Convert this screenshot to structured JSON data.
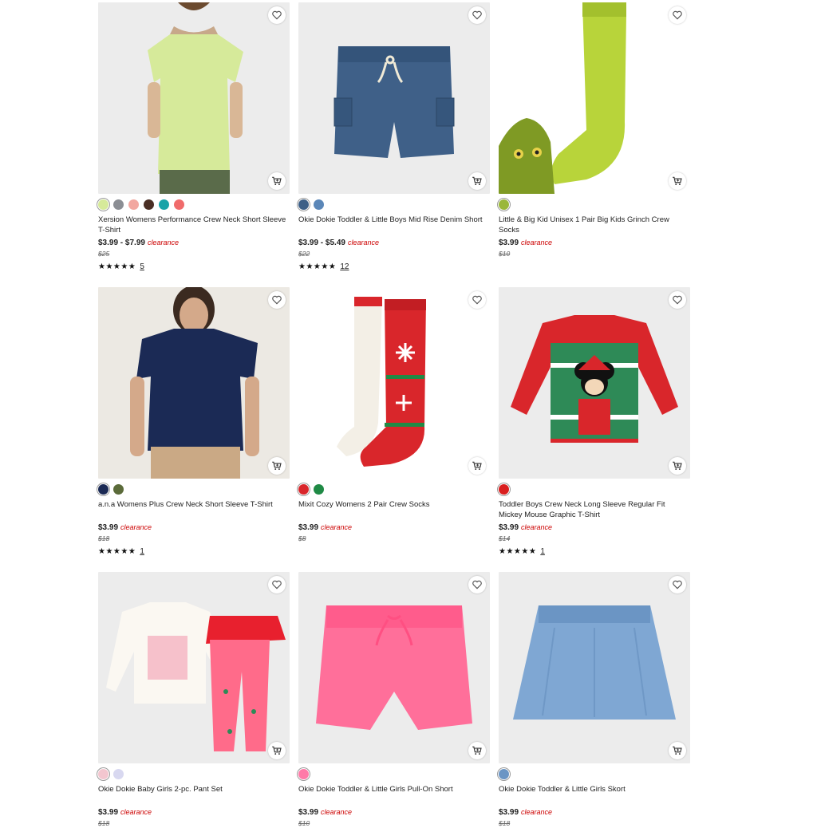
{
  "products": [
    {
      "title": "Xersion Womens Performance Crew Neck Short Sleeve T-Shirt",
      "price": "$3.99 - $7.99",
      "badge": "clearance",
      "original_price": "$25",
      "stars": "★★★★★",
      "reviews": "5",
      "swatches": [
        "#d6ea9a",
        "#8b8e94",
        "#f2a7a0",
        "#4a2e24",
        "#1aa3a8",
        "#f06b6b"
      ]
    },
    {
      "title": "Okie Dokie Toddler & Little Boys Mid Rise Denim Short",
      "price": "$3.99 - $5.49",
      "badge": "clearance",
      "original_price": "$22",
      "stars": "★★★★★",
      "reviews": "12",
      "swatches": [
        "#3d5f86",
        "#5b87b8"
      ]
    },
    {
      "title": "Little & Big Kid Unisex 1 Pair Big Kids Grinch Crew Socks",
      "price": "$3.99",
      "badge": "clearance",
      "original_price": "$10",
      "stars": "",
      "reviews": "",
      "swatches": [
        "#9ab73a"
      ]
    },
    {
      "title": "a.n.a Womens Plus Crew Neck Short Sleeve T-Shirt",
      "price": "$3.99",
      "badge": "clearance",
      "original_price": "$18",
      "stars": "★★★★★",
      "reviews": "1",
      "swatches": [
        "#1b2a55",
        "#5b6b3a"
      ]
    },
    {
      "title": "Mixit Cozy Womens 2 Pair Crew Socks",
      "price": "$3.99",
      "badge": "clearance",
      "original_price": "$8",
      "stars": "",
      "reviews": "",
      "swatches": [
        "#d9262b",
        "#1f8a45"
      ]
    },
    {
      "title": "Toddler Boys Crew Neck Long Sleeve Regular Fit Mickey Mouse Graphic T-Shirt",
      "price": "$3.99",
      "badge": "clearance",
      "original_price": "$14",
      "stars": "★★★★★",
      "reviews": "1",
      "swatches": [
        "#d91f1f"
      ]
    },
    {
      "title": "Okie Dokie Baby Girls 2-pc. Pant Set",
      "price": "$3.99",
      "badge": "clearance",
      "original_price": "$18",
      "stars": "",
      "reviews": "",
      "swatches": [
        "#f3c6cf",
        "#d8d8f0"
      ]
    },
    {
      "title": "Okie Dokie Toddler & Little Girls Pull-On Short",
      "price": "$3.99",
      "badge": "clearance",
      "original_price": "$10",
      "stars": "",
      "reviews": "",
      "swatches": [
        "#ff7aa8"
      ]
    },
    {
      "title": "Okie Dokie Toddler & Little Girls Skort",
      "price": "$3.99",
      "badge": "clearance",
      "original_price": "$18",
      "stars": "",
      "reviews": "",
      "swatches": [
        "#6b95c4"
      ]
    }
  ],
  "icons": {
    "favorite": "heart-icon",
    "add_to_cart": "cart-icon",
    "rating": "star-icon"
  },
  "colors": {
    "clearance": "#cc0000",
    "image_bg": "#ececec"
  }
}
